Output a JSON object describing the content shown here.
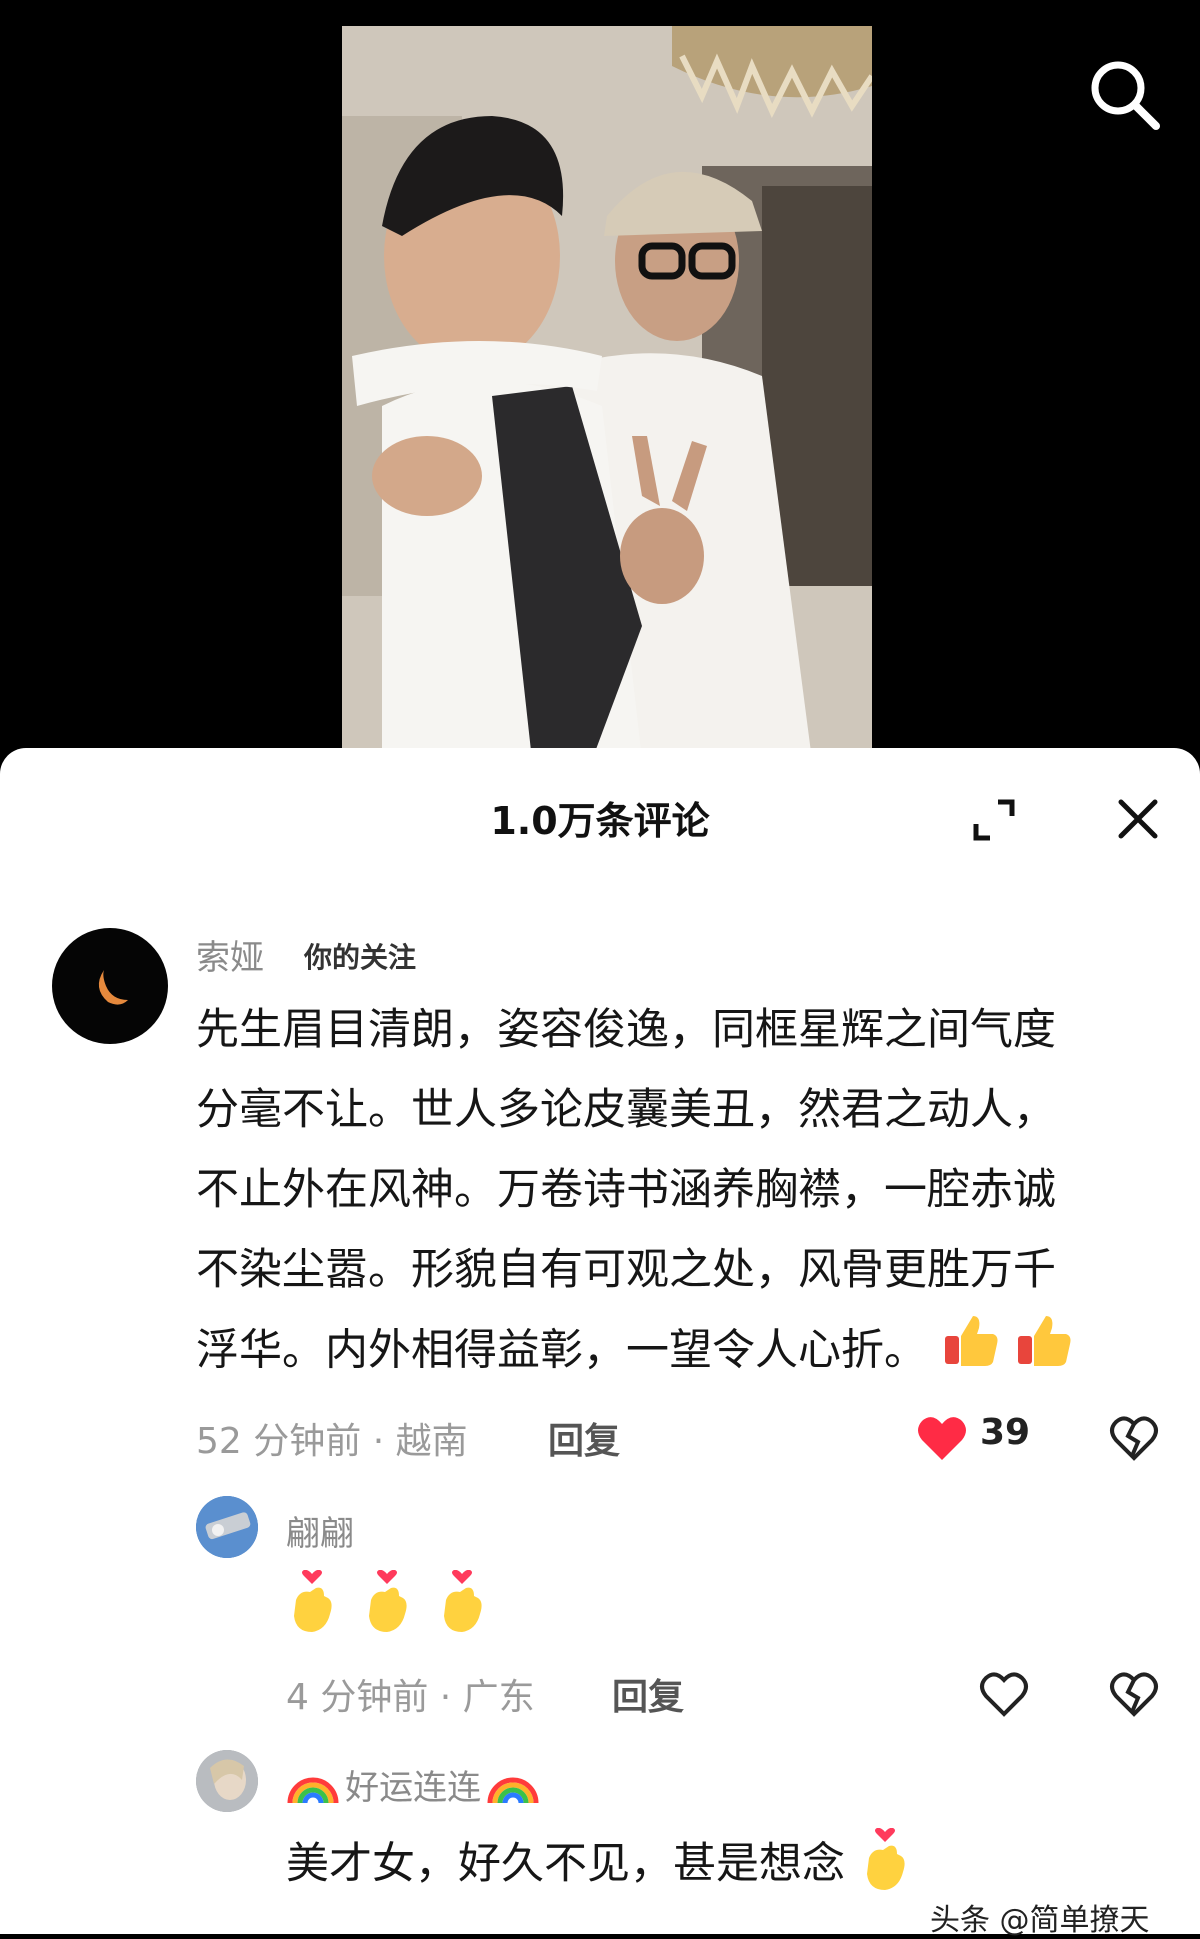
{
  "header": {
    "comment_count_title": "1.0万条评论"
  },
  "icons": {
    "search": "search-icon",
    "expand": "expand-icon",
    "close": "close-icon",
    "heart_filled": "heart-filled-icon",
    "heart_outline": "heart-outline-icon",
    "dislike": "broken-heart-icon"
  },
  "colors": {
    "like_red": "#ff2b45",
    "meta_gray": "#9a9a9a"
  },
  "comments": [
    {
      "username": "索娅",
      "follow_tag": "你的关注",
      "lines": [
        "先生眉目清朗，姿容俊逸，同框星辉之间气度",
        "分毫不让。世人多论皮囊美丑，然君之动人，",
        "不止外在风神。万卷诗书涵养胸襟，一腔赤诚",
        "不染尘嚣。形貌自有可观之处，风骨更胜万千",
        "浮华。内外相得益彰，一望令人心折。"
      ],
      "meta": "52 分钟前 · 越南",
      "reply_label": "回复",
      "likes": "39"
    },
    {
      "username": "翩翩",
      "meta": "4 分钟前 · 广东",
      "reply_label": "回复"
    },
    {
      "username": "好运连连",
      "text": "美才女，好久不见，甚是想念"
    }
  ],
  "watermark": "头条 @简单撩天"
}
